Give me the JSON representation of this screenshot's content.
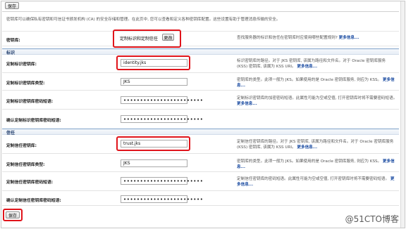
{
  "toolbar": {
    "save_top": "保存",
    "save_bottom": "保存"
  },
  "intro": "密钥库可以确保私有密钥和可信证书颁发机构 (CA) 的安全存储和管理。在此页中, 您可以查看和定义各种密钥库配置。这些设置有助于管理消息传输的安全。",
  "keystores": {
    "label": "密钥库:",
    "value": "定制标识和定制信任",
    "change_button": "更改",
    "desc": "查找服务器的标识和信任在密钥库时应使用哪些配置规则?",
    "more": "更多信息..."
  },
  "identity": {
    "title": "标识",
    "rows": [
      {
        "label": "定制标识密钥库:",
        "value": "identity.jks",
        "desc": "标识密钥库的路径。对于 JKS 密钥库, 该属为路径和文件名。对于 Oracle 密钥库服务 (KSS) 密钥库, 该属为 KSS URI。",
        "more": "更多信息..."
      },
      {
        "label": "定制标识密钥库类型:",
        "value": "JKS",
        "desc": "密钥库的类型。此项一般为 JKS。如果使用的是 Oracle 密钥库服务, 则应为 KSS。",
        "more": "更多信息..."
      },
      {
        "label": "定制标识密钥库密码短语:",
        "value": "••••••••••••••••••••••••",
        "desc": "定制标识密钥库的加密密码短语。此属性可能为空或空值, 打开密钥库时将不需要密码短语。",
        "more": "更多信息..."
      },
      {
        "label": "确认定制标识密钥库密码短语:",
        "value": "••••••••••••••••••••••••",
        "desc": "",
        "more": ""
      }
    ]
  },
  "trust": {
    "title": "信任",
    "rows": [
      {
        "label": "定制信任密钥库:",
        "value": "trust.jks",
        "desc": "定制信任密钥库的路径。对于 JKS 密钥库, 该属为路径和文件名。对于 Oracle 密钥库服务 (KSS) 密钥库, 该属为 KSS URI。",
        "more": "更多信息..."
      },
      {
        "label": "定制信任密钥库类型:",
        "value": "JKS",
        "desc": "密钥库的类型。此项一般为 JKS。如果使用的是 Oracle 密钥库服务, 则应为 KSS。",
        "more": "更多信息..."
      },
      {
        "label": "定制信任密钥库密码短语:",
        "value": "••••••••••••••••••••••••",
        "desc": "定制信任密钥库的密码短语。此属性可能为空或空值, 打开密钥库时将不需要密码短语。",
        "more": "更多信息..."
      },
      {
        "label": "确认定制信任密钥库密码短语:",
        "value": "••••••••••••••••••••••••",
        "desc": "",
        "more": ""
      }
    ]
  },
  "watermark": "@51CTO博客",
  "colors": {
    "highlight": "#e0141b",
    "link": "#1f4fa3",
    "section_border": "#7fa2c9"
  }
}
